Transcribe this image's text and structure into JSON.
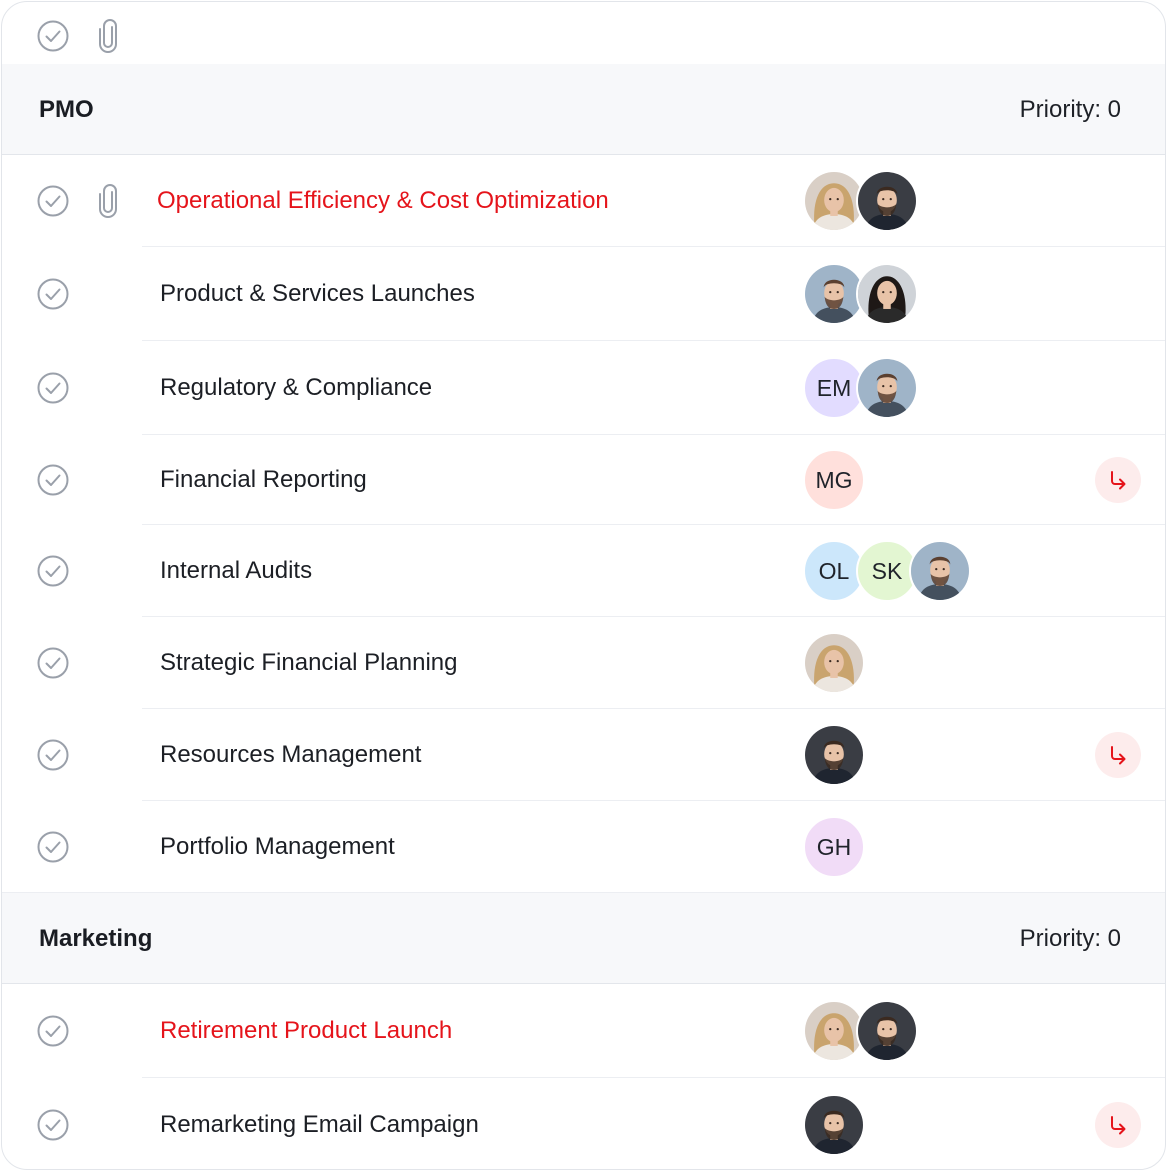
{
  "toolbar": {
    "icons": [
      "check-circle-icon",
      "paperclip-icon"
    ]
  },
  "groups": [
    {
      "name": "PMO",
      "priority": "Priority: 0",
      "tasks": [
        {
          "title": "Operational Efficiency & Cost Optimization",
          "highlight": true,
          "attachment": true,
          "assignees": [
            {
              "type": "photo",
              "hair": "blonde"
            },
            {
              "type": "photo",
              "hair": "dark-beard"
            }
          ],
          "subtask": false
        },
        {
          "title": "Product & Services Launches",
          "highlight": false,
          "attachment": false,
          "assignees": [
            {
              "type": "photo",
              "hair": "brown-beard"
            },
            {
              "type": "photo",
              "hair": "long-dark"
            }
          ],
          "subtask": false
        },
        {
          "title": "Regulatory & Compliance",
          "highlight": false,
          "attachment": false,
          "assignees": [
            {
              "type": "initials",
              "initials": "EM",
              "color": "#e2dcff"
            },
            {
              "type": "photo",
              "hair": "brown-beard"
            }
          ],
          "subtask": false
        },
        {
          "title": "Financial Reporting",
          "highlight": false,
          "attachment": false,
          "assignees": [
            {
              "type": "initials",
              "initials": "MG",
              "color": "#ffe0dc"
            }
          ],
          "subtask": true
        },
        {
          "title": "Internal Audits",
          "highlight": false,
          "attachment": false,
          "assignees": [
            {
              "type": "initials",
              "initials": "OL",
              "color": "#cce7fb"
            },
            {
              "type": "initials",
              "initials": "SK",
              "color": "#e3f6d2"
            },
            {
              "type": "photo",
              "hair": "brown-beard"
            }
          ],
          "subtask": false
        },
        {
          "title": "Strategic Financial Planning",
          "highlight": false,
          "attachment": false,
          "assignees": [
            {
              "type": "photo",
              "hair": "blonde"
            }
          ],
          "subtask": false
        },
        {
          "title": "Resources Management",
          "highlight": false,
          "attachment": false,
          "assignees": [
            {
              "type": "photo",
              "hair": "dark-beard"
            }
          ],
          "subtask": true
        },
        {
          "title": "Portfolio Management",
          "highlight": false,
          "attachment": false,
          "assignees": [
            {
              "type": "initials",
              "initials": "GH",
              "color": "#f1dcf7"
            }
          ],
          "subtask": false
        }
      ]
    },
    {
      "name": "Marketing",
      "priority": "Priority: 0",
      "tasks": [
        {
          "title": "Retirement Product Launch",
          "highlight": true,
          "attachment": false,
          "assignees": [
            {
              "type": "photo",
              "hair": "blonde"
            },
            {
              "type": "photo",
              "hair": "dark-beard"
            }
          ],
          "subtask": false
        },
        {
          "title": "Remarketing Email Campaign",
          "highlight": false,
          "attachment": false,
          "assignees": [
            {
              "type": "photo",
              "hair": "dark-beard"
            }
          ],
          "subtask": true
        }
      ]
    }
  ],
  "colors": {
    "highlight_text": "#e5141b",
    "subtask_bg": "#fdecec",
    "subtask_icon": "#e5141b",
    "check_icon": "#9aa0aa"
  }
}
